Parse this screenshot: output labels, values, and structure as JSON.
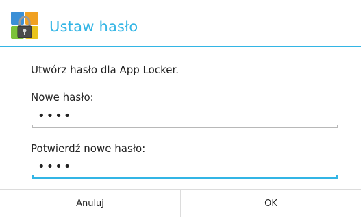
{
  "dialog": {
    "title": "Ustaw hasło",
    "message": "Utwórz hasło dla App Locker.",
    "new_password": {
      "label": "Nowe hasło:",
      "value": "••••"
    },
    "confirm_password": {
      "label": "Potwierdź nowe hasło:",
      "value": "••••"
    },
    "buttons": {
      "cancel": "Anuluj",
      "ok": "OK"
    }
  },
  "colors": {
    "accent": "#33b5e5",
    "text": "#222222",
    "divider": "#dcdcdc"
  },
  "icons": {
    "app": "app-locker-padlock-icon"
  }
}
